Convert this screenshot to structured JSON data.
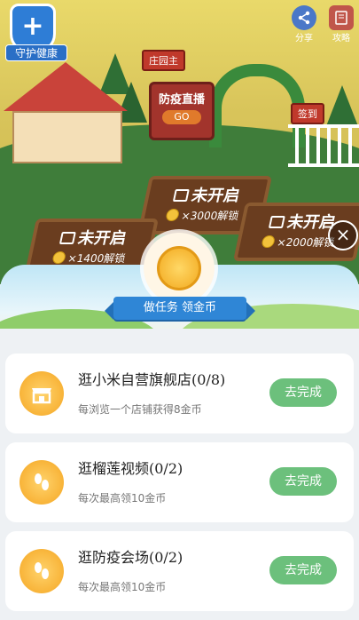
{
  "game": {
    "badge_label": "守护健康",
    "share_label": "分享",
    "guide_label": "攻略",
    "signpost_left": "庄园主",
    "signpost_right": "签到",
    "live_sign_title": "防疫直播",
    "live_sign_go": "GO",
    "plots": [
      {
        "name": "未开启",
        "cost": "×3000解锁"
      },
      {
        "name": "未开启",
        "cost": "×1400解锁"
      },
      {
        "name": "未开启",
        "cost": "×2000解锁"
      }
    ]
  },
  "panel": {
    "ribbon_text": "做任务 领金币",
    "close_icon": "close-icon"
  },
  "tasks": [
    {
      "title": "逛小米自营旗舰店(0/8)",
      "desc": "每浏览一个店铺获得8金币",
      "button": "去完成",
      "icon": "store-icon"
    },
    {
      "title": "逛榴莲视频(0/2)",
      "desc": "每次最高领10金币",
      "button": "去完成",
      "icon": "footprints-icon"
    },
    {
      "title": "逛防疫会场(0/2)",
      "desc": "每次最高领10金币",
      "button": "去完成",
      "icon": "footprints-icon"
    }
  ]
}
